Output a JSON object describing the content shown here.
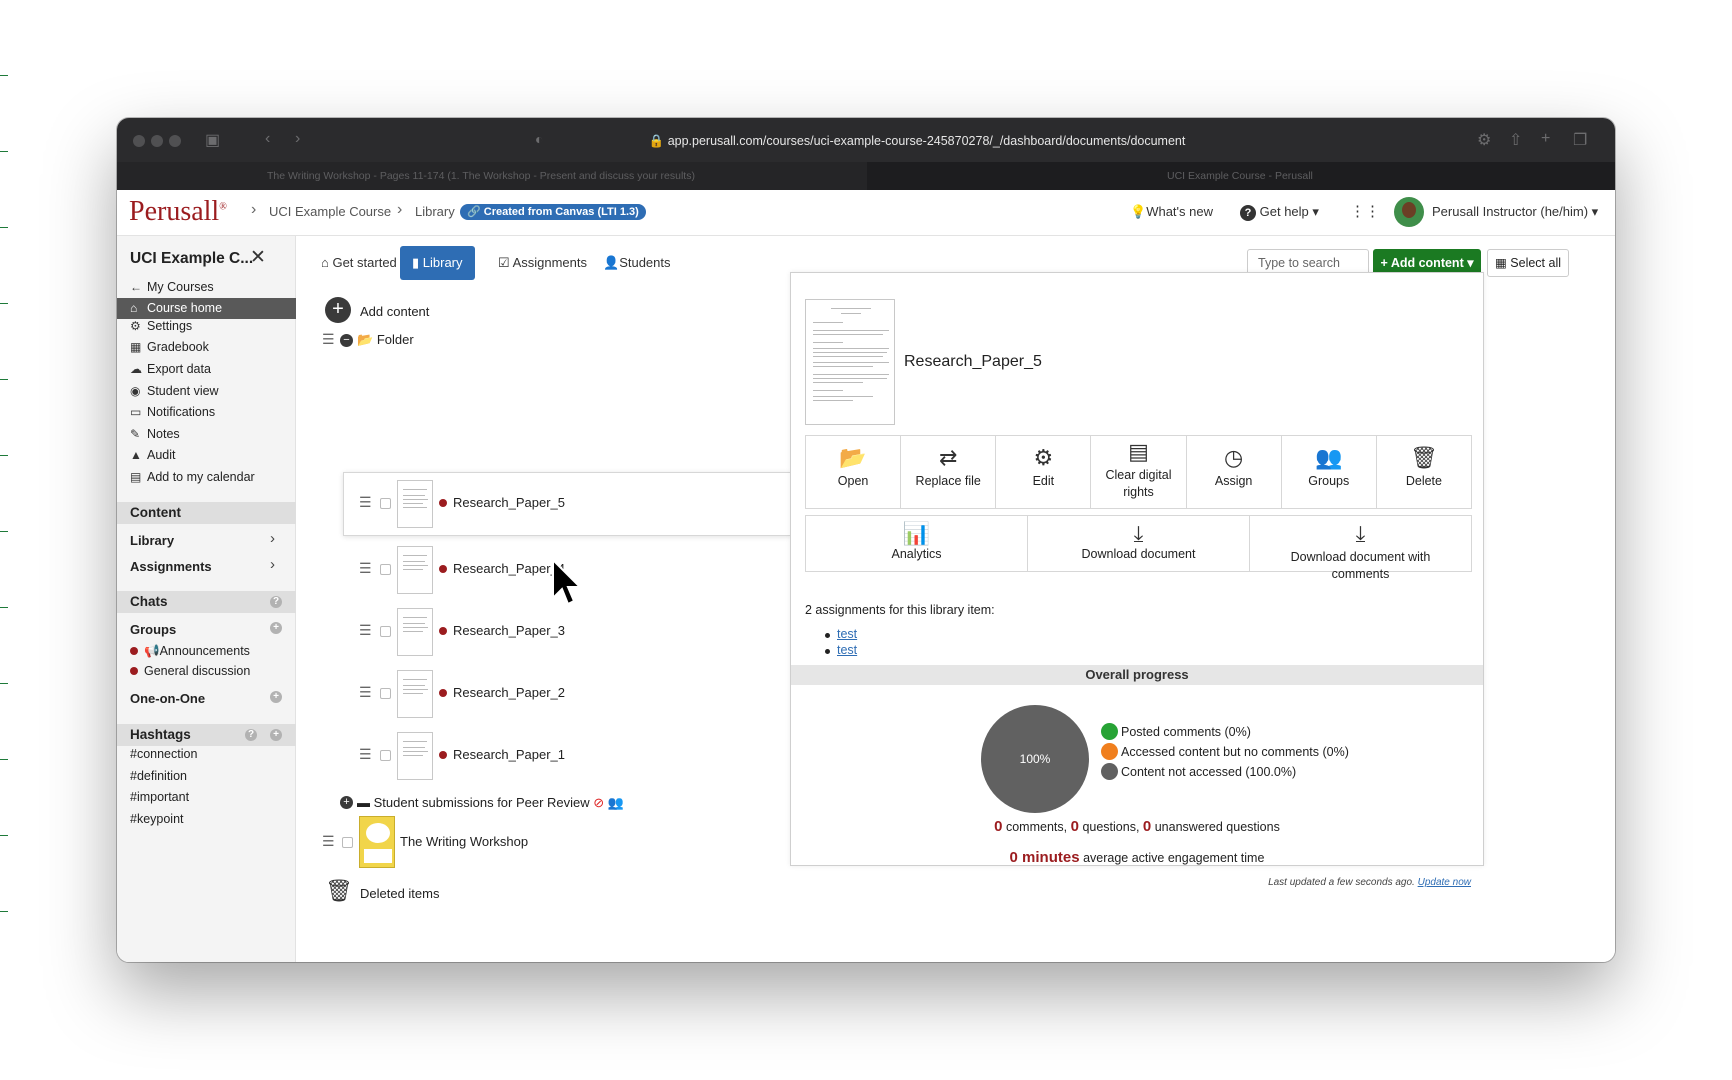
{
  "browser": {
    "url": "app.perusall.com/courses/uci-example-course-245870278/_/dashboard/documents/document",
    "tabs": [
      "The Writing Workshop - Pages 11-174 (1. The Workshop - Present and discuss your results)",
      "UCI Example Course - Perusall"
    ]
  },
  "header": {
    "logo": "Perusall",
    "logo_mark": "®",
    "breadcrumb": [
      "UCI Example Course",
      "Library"
    ],
    "lti_badge": "Created from Canvas (LTI 1.3)",
    "whats_new": "What's new",
    "get_help": "Get help",
    "user": "Perusall Instructor (he/him)"
  },
  "sidebar": {
    "course_title": "UCI Example C...",
    "nav": [
      {
        "label": "My Courses",
        "icon": "arrow-left-icon"
      },
      {
        "label": "Course home",
        "icon": "home-icon"
      },
      {
        "label": "Settings",
        "icon": "gear-icon"
      },
      {
        "label": "Gradebook",
        "icon": "table-icon"
      },
      {
        "label": "Export data",
        "icon": "cloud-download-icon"
      },
      {
        "label": "Student view",
        "icon": "eye-icon"
      },
      {
        "label": "Notifications",
        "icon": "inbox-icon"
      },
      {
        "label": "Notes",
        "icon": "pencil-icon"
      },
      {
        "label": "Audit",
        "icon": "warning-icon"
      },
      {
        "label": "Add to my calendar",
        "icon": "calendar-icon"
      }
    ],
    "content_header": "Content",
    "library": "Library",
    "assignments": "Assignments",
    "chats_header": "Chats",
    "groups": "Groups",
    "announcements": "Announcements",
    "general_discussion": "General discussion",
    "one_on_one": "One-on-One",
    "hashtags_header": "Hashtags",
    "hashtags": [
      "#connection",
      "#definition",
      "#important",
      "#keypoint"
    ]
  },
  "tabs": {
    "get_started": "Get started",
    "library": "Library",
    "assignments": "Assignments",
    "students": "Students"
  },
  "toolbar": {
    "search_placeholder": "Type to search",
    "add_content": "+ Add content ▾",
    "select_all": "Select all"
  },
  "library": {
    "add_content": "Add content",
    "folder": "Folder",
    "docs": [
      "Research_Paper_5",
      "Research_Paper_4",
      "Research_Paper_3",
      "Research_Paper_2",
      "Research_Paper_1"
    ],
    "peer_review": "Student submissions for Peer Review",
    "book": "The Writing Workshop",
    "deleted": "Deleted items"
  },
  "detail": {
    "title": "Research_Paper_5",
    "actions": [
      "Open",
      "Replace file",
      "Edit",
      "Clear digital rights",
      "Assign",
      "Groups",
      "Delete"
    ],
    "actions2": [
      "Analytics",
      "Download document",
      "Download document with comments"
    ],
    "assignments_count": "2 assignments for this library item:",
    "assignments": [
      "test",
      "test"
    ],
    "progress_title": "Overall progress",
    "pie_label": "100%",
    "legend": [
      {
        "label": "Posted comments (0%)",
        "color": "#27a335"
      },
      {
        "label": "Accessed content but no comments (0%)",
        "color": "#f07f1e"
      },
      {
        "label": "Content not accessed (100.0%)",
        "color": "#616161"
      }
    ],
    "stats": {
      "comments": "0",
      "comments_label": "comments,",
      "questions": "0",
      "questions_label": "questions,",
      "unanswered": "0",
      "unanswered_label": "unanswered questions",
      "minutes": "0 minutes",
      "minutes_label": "average active engagement time"
    },
    "last_updated": "Last updated a few seconds ago.",
    "update_now": "Update now"
  },
  "colors": {
    "brand": "#9b1c1f",
    "accent": "#2e6db4",
    "add_green": "#1b7a22"
  }
}
